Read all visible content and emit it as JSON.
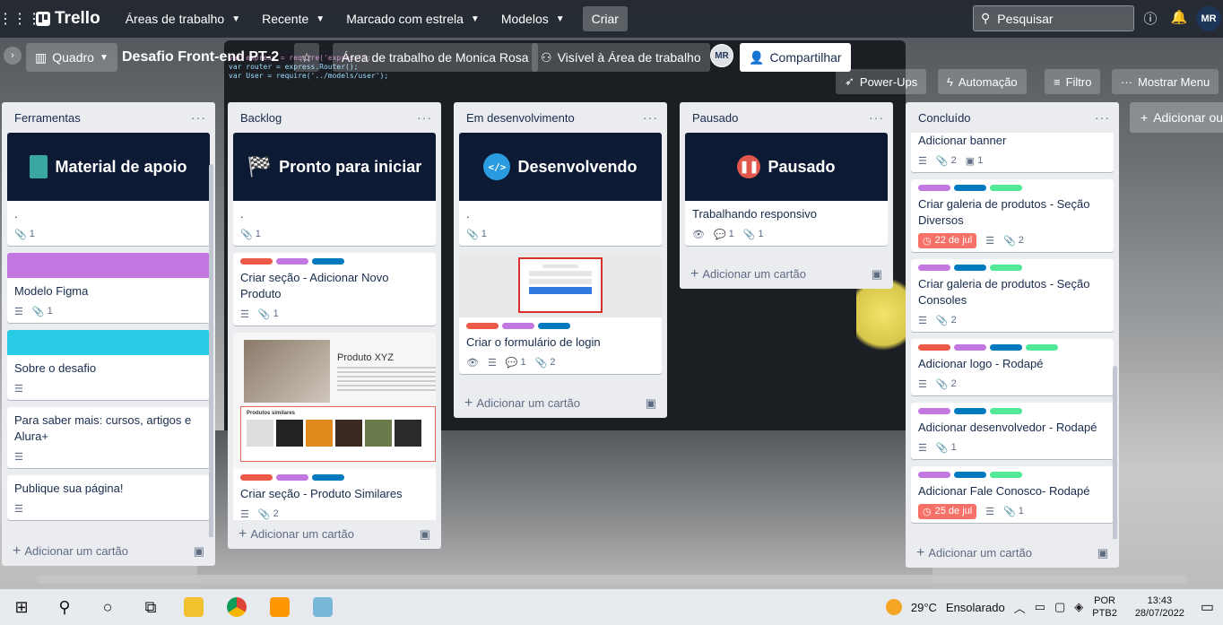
{
  "topnav": {
    "logo": "Trello",
    "workspaces": "Áreas de trabalho",
    "recent": "Recente",
    "starred": "Marcado com estrela",
    "templates": "Modelos",
    "create": "Criar",
    "search_placeholder": "Pesquisar",
    "avatar": "MR"
  },
  "board": {
    "view": "Quadro",
    "title": "Desafio Front-end PT-2",
    "workspace": "Área de trabalho de Monica Rosa",
    "visibility": "Visível à Área de trabalho",
    "member": "MR",
    "share": "Compartilhar",
    "powerups": "Power-Ups",
    "automation": "Automação",
    "filter": "Filtro",
    "menu": "Mostrar Menu",
    "add_list": "Adicionar out"
  },
  "add_card_label": "Adicionar um cartão",
  "lists": [
    {
      "name": "Ferramentas",
      "cards": [
        {
          "cover": "Material de apoio",
          "title": ".",
          "attachments": "1"
        },
        {
          "title": "Modelo Figma",
          "attachments": "1",
          "cover_color": "#c377e0"
        },
        {
          "title": "Sobre o desafio",
          "cover_color": "#29cce5"
        },
        {
          "title": "Para saber mais: cursos, artigos e Alura+"
        },
        {
          "title": "Publique sua página!"
        }
      ]
    },
    {
      "name": "Backlog",
      "cards": [
        {
          "cover": "Pronto para iniciar",
          "title": ".",
          "attachments": "1"
        },
        {
          "title": "Criar seção - Adicionar Novo Produto",
          "attachments": "1"
        },
        {
          "title": "Criar seção - Produto Similares",
          "attachments": "2",
          "preview_title": "Produto XYZ",
          "preview_sub": "Produtos similares"
        }
      ]
    },
    {
      "name": "Em desenvolvimento",
      "cards": [
        {
          "cover": "Desenvolvendo",
          "title": ".",
          "attachments": "1"
        },
        {
          "title": "Criar o formulário de login",
          "comments": "1",
          "attachments": "2"
        }
      ]
    },
    {
      "name": "Pausado",
      "cards": [
        {
          "cover": "Pausado",
          "title": "Trabalhando responsivo",
          "comments": "1",
          "attachments": "1"
        }
      ]
    },
    {
      "name": "Concluído",
      "cards": [
        {
          "title": "Adicionar banner",
          "attachments": "2",
          "checklist": "1"
        },
        {
          "title": "Criar galeria de produtos - Seção Diversos",
          "date": "22 de jul",
          "attachments": "2"
        },
        {
          "title": "Criar galeria de produtos - Seção Consoles",
          "attachments": "2"
        },
        {
          "title": "Adicionar logo - Rodapé",
          "attachments": "2"
        },
        {
          "title": "Adicionar desenvolvedor - Rodapé",
          "attachments": "1"
        },
        {
          "title": "Adicionar Fale Conosco- Rodapé",
          "date": "25 de jul",
          "attachments": "1"
        }
      ]
    }
  ],
  "labels": {
    "red": "#eb5a46",
    "purple": "#c377e0",
    "blue": "#0079bf",
    "green": "#51e898"
  },
  "taskbar": {
    "weather": "29°C",
    "weather_desc": "Ensolarado",
    "lang1": "POR",
    "lang2": "PTB2",
    "time": "13:43",
    "date": "28/07/2022"
  }
}
